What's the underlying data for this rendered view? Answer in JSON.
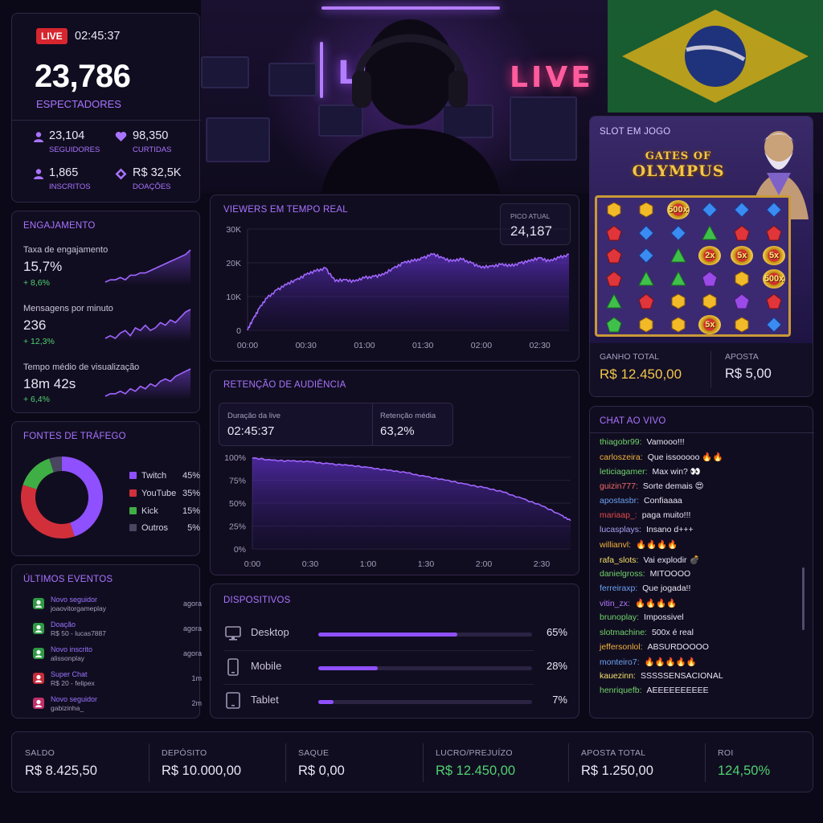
{
  "live": {
    "badge": "LIVE",
    "timer": "02:45:37",
    "viewers": "23,786",
    "viewers_label": "ESPECTADORES",
    "stats": [
      {
        "value": "23,104",
        "label": "SEGUIDORES",
        "icon": "user-icon"
      },
      {
        "value": "98,350",
        "label": "CURTIDAS",
        "icon": "heart-icon"
      },
      {
        "value": "1,865",
        "label": "INSCRITOS",
        "icon": "subscriber-icon"
      },
      {
        "value": "R$ 32,5K",
        "label": "DOAÇÕES",
        "icon": "diamond-icon"
      }
    ]
  },
  "hero": {
    "neon_text": "LIVE"
  },
  "engagement": {
    "title": "ENGAJAMENTO",
    "items": [
      {
        "label": "Taxa de engajamento",
        "value": "15,7%",
        "delta": "+ 8,6%",
        "trend": [
          2,
          3,
          3,
          4,
          3,
          5,
          5,
          6,
          6,
          7,
          8,
          9,
          10,
          11,
          12,
          13,
          14,
          16
        ]
      },
      {
        "label": "Mensagens por minuto",
        "value": "236",
        "delta": "+ 12,3%",
        "trend": [
          2,
          3,
          2,
          4,
          5,
          3,
          6,
          5,
          7,
          5,
          6,
          8,
          7,
          9,
          8,
          10,
          12,
          13
        ]
      },
      {
        "label": "Tempo médio de visualização",
        "value": "18m 42s",
        "delta": "+ 6,4%",
        "trend": [
          2,
          3,
          3,
          4,
          3,
          5,
          4,
          6,
          5,
          7,
          6,
          8,
          9,
          8,
          10,
          11,
          12,
          13
        ]
      }
    ]
  },
  "traffic": {
    "title": "FONTES DE TRÁFEGO",
    "sources": [
      {
        "name": "Twitch",
        "pct": "45%",
        "value": 45,
        "color": "#8f50ff"
      },
      {
        "name": "YouTube",
        "pct": "35%",
        "value": 35,
        "color": "#d1303a"
      },
      {
        "name": "Kick",
        "pct": "15%",
        "value": 15,
        "color": "#3faf45"
      },
      {
        "name": "Outros",
        "pct": "5%",
        "value": 5,
        "color": "#4a4560"
      }
    ]
  },
  "events": {
    "title": "ÚLTIMOS EVENTOS",
    "items": [
      {
        "title": "Novo seguidor",
        "detail": "joaovitorgameplay",
        "time": "agora",
        "color": "#2f9a45",
        "icon": "user-icon"
      },
      {
        "title": "Doação",
        "detail": "R$ 50 - lucas7887",
        "time": "agora",
        "color": "#2f9a45",
        "icon": "money-icon"
      },
      {
        "title": "Novo inscrito",
        "detail": "alissonplay",
        "time": "agora",
        "color": "#2f9a45",
        "icon": "star-icon"
      },
      {
        "title": "Super Chat",
        "detail": "R$ 20 - felipex",
        "time": "1m",
        "color": "#c62c3a",
        "icon": "chat-icon"
      },
      {
        "title": "Novo seguidor",
        "detail": "gabizinha_",
        "time": "2m",
        "color": "#c0306a",
        "icon": "heart-icon"
      }
    ]
  },
  "realtime": {
    "title": "VIEWERS EM TEMPO REAL",
    "peak_label": "PICO ATUAL",
    "peak_value": "24,187"
  },
  "retention": {
    "title": "RETENÇÃO DE AUDIÊNCIA",
    "duration_label": "Duração da live",
    "duration_value": "02:45:37",
    "avg_label": "Retenção média",
    "avg_value": "63,2%"
  },
  "chart_data": [
    {
      "type": "area",
      "title": "VIEWERS EM TEMPO REAL",
      "x_ticks": [
        "00:00",
        "00:30",
        "01:00",
        "01:30",
        "02:00",
        "02:30"
      ],
      "y_ticks": [
        "0",
        "10K",
        "20K",
        "30K"
      ],
      "ylim": [
        0,
        30000
      ],
      "xlim": [
        0,
        165
      ],
      "x": [
        0,
        3,
        6,
        10,
        15,
        20,
        25,
        30,
        35,
        40,
        45,
        50,
        55,
        60,
        65,
        70,
        75,
        80,
        85,
        90,
        95,
        100,
        105,
        110,
        115,
        120,
        125,
        130,
        135,
        140,
        145,
        150,
        155,
        160,
        165
      ],
      "values": [
        0,
        3500,
        6500,
        9500,
        12000,
        13500,
        15000,
        16500,
        17500,
        18500,
        14500,
        15000,
        14500,
        15500,
        16000,
        16500,
        18500,
        20000,
        20500,
        21500,
        22500,
        21500,
        20500,
        21000,
        20000,
        18500,
        19000,
        19500,
        19000,
        20000,
        20500,
        21500,
        20500,
        21500,
        22500
      ]
    },
    {
      "type": "area",
      "title": "RETENÇÃO DE AUDIÊNCIA",
      "x_ticks": [
        "0:00",
        "0:30",
        "1:00",
        "1:30",
        "2:00",
        "2:30"
      ],
      "y_ticks": [
        "0%",
        "25%",
        "50%",
        "75%",
        "100%"
      ],
      "ylim": [
        0,
        100
      ],
      "xlim": [
        0,
        165
      ],
      "x": [
        0,
        10,
        20,
        30,
        40,
        50,
        60,
        70,
        80,
        90,
        100,
        110,
        120,
        130,
        140,
        150,
        160,
        165
      ],
      "values": [
        99,
        97,
        96,
        95,
        93,
        91,
        89,
        86,
        83,
        79,
        75,
        71,
        67,
        62,
        55,
        47,
        37,
        31
      ]
    }
  ],
  "slot": {
    "title": "SLOT EM JOGO",
    "game_name_line1": "GATES OF",
    "game_name_line2": "OLYMPUS",
    "win_label": "GANHO TOTAL",
    "win_value": "R$ 12.450,00",
    "bet_label": "APOSTA",
    "bet_value": "R$ 5,00",
    "grid": [
      [
        "hex-gold",
        "hex-gold",
        "500x",
        "diamond-blue",
        "diamond-blue",
        "diamond-blue"
      ],
      [
        "pent-red",
        "diamond-blue",
        "diamond-blue",
        "tri-green",
        "pent-red",
        "pent-red"
      ],
      [
        "pent-red",
        "diamond-blue",
        "tri-green",
        "2x",
        "5x",
        "5x"
      ],
      [
        "pent-red",
        "tri-green",
        "tri-green",
        "pent-purple",
        "hex-gold",
        "500x"
      ],
      [
        "tri-green",
        "pent-red",
        "hex-gold",
        "hex-gold",
        "pent-purple",
        "pent-red"
      ],
      [
        "pent-green",
        "hex-gold",
        "hex-gold",
        "5x",
        "hex-gold",
        "diamond-blue"
      ]
    ]
  },
  "chat": {
    "title": "CHAT AO VIVO",
    "messages": [
      {
        "user": "thiagobr99:",
        "text": "Vamooo!!!",
        "color": "#6fd36a"
      },
      {
        "user": "carloszeira:",
        "text": "Que issooooo 🔥🔥",
        "color": "#f2b23c"
      },
      {
        "user": "leticiagamer:",
        "text": "Max win? 👀",
        "color": "#6fd36a"
      },
      {
        "user": "guizin777:",
        "text": "Sorte demais 😍",
        "color": "#f26a6a"
      },
      {
        "user": "apostasbr:",
        "text": "Confiaaaa",
        "color": "#6aa2f2"
      },
      {
        "user": "mariaap_:",
        "text": "paga muito!!!",
        "color": "#e04a4a"
      },
      {
        "user": "lucasplays:",
        "text": "Insano d+++",
        "color": "#a4a0f0"
      },
      {
        "user": "willianvl:",
        "text": "🔥🔥🔥🔥",
        "color": "#f2b23c"
      },
      {
        "user": "rafa_slots:",
        "text": "Vai explodir 💣",
        "color": "#f2e06a"
      },
      {
        "user": "danielgross:",
        "text": "MITOOOO",
        "color": "#6fd36a"
      },
      {
        "user": "ferreiraxp:",
        "text": "Que jogada!!",
        "color": "#6aa2f2"
      },
      {
        "user": "vitin_zx:",
        "text": "🔥🔥🔥🔥",
        "color": "#b07aff"
      },
      {
        "user": "brunoplay:",
        "text": "Impossivel",
        "color": "#6fd36a"
      },
      {
        "user": "slotmachine:",
        "text": "500x é real",
        "color": "#6fd36a"
      },
      {
        "user": "jeffersonlol:",
        "text": "ABSURDOOOO",
        "color": "#f2b23c"
      },
      {
        "user": "monteiro7:",
        "text": "🔥🔥🔥🔥🔥",
        "color": "#6aa2f2"
      },
      {
        "user": "kauezinn:",
        "text": "SSSSSENSACIONAL",
        "color": "#f2e06a"
      },
      {
        "user": "henriquefb:",
        "text": "AEEEEEEEEEE",
        "color": "#6fd36a"
      }
    ]
  },
  "devices": {
    "title": "DISPOSITIVOS",
    "items": [
      {
        "name": "Desktop",
        "pct": "65%",
        "value": 0.65,
        "icon": "desktop-icon"
      },
      {
        "name": "Mobile",
        "pct": "28%",
        "value": 0.28,
        "icon": "mobile-icon"
      },
      {
        "name": "Tablet",
        "pct": "7%",
        "value": 0.07,
        "icon": "tablet-icon"
      }
    ]
  },
  "summary": [
    {
      "label": "SALDO",
      "value": "R$ 8.425,50",
      "color": "#e9e6f5"
    },
    {
      "label": "DEPÓSITO",
      "value": "R$ 10.000,00",
      "color": "#e9e6f5"
    },
    {
      "label": "SAQUE",
      "value": "R$ 0,00",
      "color": "#e9e6f5"
    },
    {
      "label": "LUCRO/PREJUÍZO",
      "value": "R$ 12.450,00",
      "color": "#4fd170"
    },
    {
      "label": "APOSTA TOTAL",
      "value": "R$ 1.250,00",
      "color": "#e9e6f5"
    },
    {
      "label": "ROI",
      "value": "124,50%",
      "color": "#4fd170"
    }
  ]
}
